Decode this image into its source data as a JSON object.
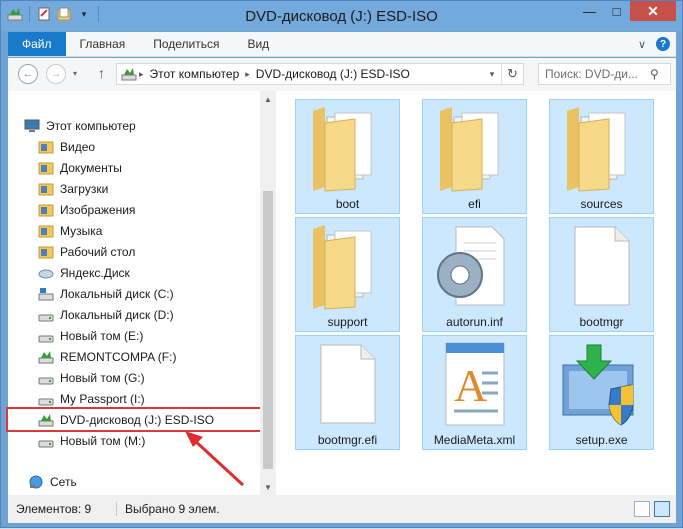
{
  "window": {
    "title": "DVD-дисковод (J:) ESD-ISO",
    "minimize_glyph": "—",
    "maximize_glyph": "□",
    "close_glyph": "✕"
  },
  "ribbon": {
    "tabs": [
      "Файл",
      "Главная",
      "Поделиться",
      "Вид"
    ],
    "collapse_glyph": "∨",
    "help_glyph": "?"
  },
  "nav": {
    "back_glyph": "←",
    "forward_glyph": "→",
    "up_glyph": "↑",
    "breadcrumb": [
      "Этот компьютер",
      "DVD-дисковод (J:) ESD-ISO"
    ],
    "search_placeholder": "Поиск: DVD-ди..."
  },
  "sidebar": {
    "items": [
      {
        "label": "Этот компьютер",
        "icon": "computer-icon"
      },
      {
        "label": "Видео",
        "icon": "video-folder-icon"
      },
      {
        "label": "Документы",
        "icon": "documents-folder-icon"
      },
      {
        "label": "Загрузки",
        "icon": "downloads-folder-icon"
      },
      {
        "label": "Изображения",
        "icon": "pictures-folder-icon"
      },
      {
        "label": "Музыка",
        "icon": "music-folder-icon"
      },
      {
        "label": "Рабочий стол",
        "icon": "desktop-folder-icon"
      },
      {
        "label": "Яндекс.Диск",
        "icon": "cloud-drive-icon"
      },
      {
        "label": "Локальный диск (C:)",
        "icon": "system-drive-icon"
      },
      {
        "label": "Локальный диск (D:)",
        "icon": "drive-icon"
      },
      {
        "label": "Новый том (E:)",
        "icon": "drive-icon"
      },
      {
        "label": "REMONTCOMPA (F:)",
        "icon": "removable-drive-icon"
      },
      {
        "label": "Новый том (G:)",
        "icon": "drive-icon"
      },
      {
        "label": "My Passport (I:)",
        "icon": "drive-icon"
      },
      {
        "label": "DVD-дисковод (J:) ESD-ISO",
        "icon": "dvd-drive-icon"
      },
      {
        "label": "Новый том (M:)",
        "icon": "drive-icon"
      },
      {
        "label": "Сеть",
        "icon": "network-icon"
      }
    ],
    "selected_index": 14
  },
  "files": [
    {
      "name": "boot",
      "icon": "folder-icon"
    },
    {
      "name": "efi",
      "icon": "folder-icon"
    },
    {
      "name": "sources",
      "icon": "folder-icon"
    },
    {
      "name": "support",
      "icon": "folder-icon"
    },
    {
      "name": "autorun.inf",
      "icon": "settings-file-icon"
    },
    {
      "name": "bootmgr",
      "icon": "file-icon"
    },
    {
      "name": "bootmgr.efi",
      "icon": "file-icon"
    },
    {
      "name": "MediaMeta.xml",
      "icon": "document-file-icon"
    },
    {
      "name": "setup.exe",
      "icon": "installer-icon"
    }
  ],
  "status": {
    "items_count": "Элементов: 9",
    "selected_count": "Выбрано 9 элем."
  },
  "colors": {
    "title_bar": "#74a9dd",
    "file_tab": "#1979ca",
    "selection_fill": "#cce8ff",
    "selection_border": "#99d1ff",
    "annotation_red": "#d43a3f"
  }
}
